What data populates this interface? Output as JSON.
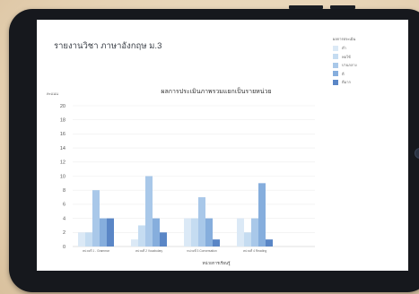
{
  "report": {
    "title": "รายงานวิชา ภาษาอังกฤษ ม.3"
  },
  "legend": {
    "title": "ผลการประเมิน",
    "items": [
      {
        "label": "ต่ำ",
        "color": "#dbe9f6"
      },
      {
        "label": "พอใช้",
        "color": "#c5dcf1"
      },
      {
        "label": "ปานกลาง",
        "color": "#a9c8e9"
      },
      {
        "label": "ดี",
        "color": "#86aedd"
      },
      {
        "label": "ดีมาก",
        "color": "#5a86c6"
      }
    ]
  },
  "colors": {
    "frame": "#16181d",
    "background": "#e9d8bd",
    "grid": "#eeeeee"
  },
  "chart_data": {
    "type": "bar",
    "title": "ผลการประเมินภาพรวมแยกเป็นรายหน่วย",
    "xlabel": "หน่วยการเรียนรู้",
    "ylabel": "คะแนน",
    "ylim": [
      0,
      20
    ],
    "yticks": [
      0,
      2,
      4,
      6,
      8,
      10,
      12,
      14,
      16,
      18,
      20
    ],
    "grid": true,
    "legend_position": "top-right",
    "categories": [
      "หน่วยที่ 1 - Grammar",
      "หน่วยที่ 2 Vocabulary",
      "หน่วยที่ 3 Conversation",
      "หน่วยที่ 4 Reading"
    ],
    "series": [
      {
        "name": "ต่ำ",
        "values": [
          2,
          1,
          4,
          4
        ]
      },
      {
        "name": "พอใช้",
        "values": [
          2,
          3,
          4,
          2
        ]
      },
      {
        "name": "ปานกลาง",
        "values": [
          8,
          10,
          7,
          4
        ]
      },
      {
        "name": "ดี",
        "values": [
          4,
          4,
          4,
          9
        ]
      },
      {
        "name": "ดีมาก",
        "values": [
          4,
          2,
          1,
          1
        ]
      }
    ]
  }
}
